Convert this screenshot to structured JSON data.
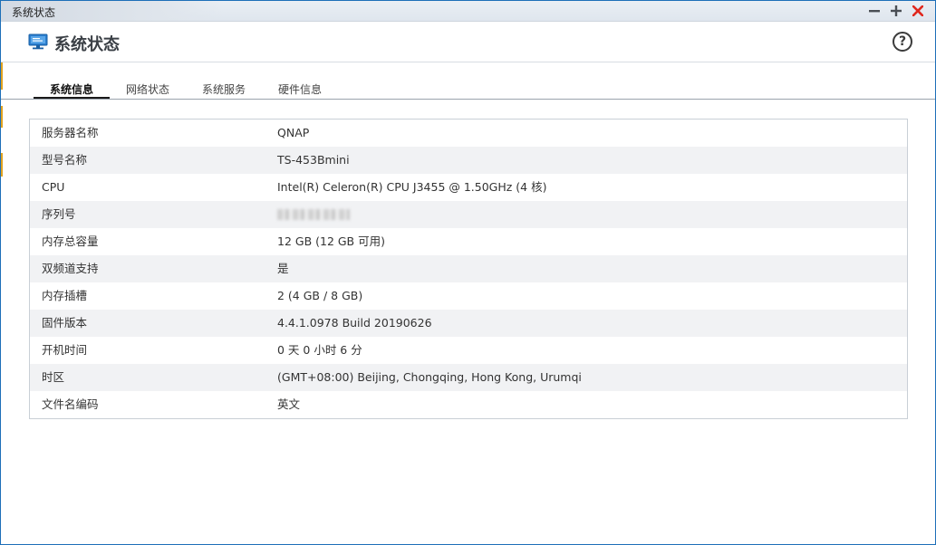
{
  "window": {
    "title": "系统状态",
    "controls": {
      "minimize": "−",
      "maximize": "+",
      "close": "✕"
    }
  },
  "header": {
    "icon": "monitor-icon",
    "title": "系统状态",
    "help": "?"
  },
  "tabs": [
    {
      "label": "系统信息",
      "active": true
    },
    {
      "label": "网络状态",
      "active": false
    },
    {
      "label": "系统服务",
      "active": false
    },
    {
      "label": "硬件信息",
      "active": false
    }
  ],
  "system_info": [
    {
      "label": "服务器名称",
      "value": "QNAP"
    },
    {
      "label": "型号名称",
      "value": "TS-453Bmini"
    },
    {
      "label": "CPU",
      "value": "Intel(R) Celeron(R) CPU J3455 @ 1.50GHz (4 核)"
    },
    {
      "label": "序列号",
      "value": "",
      "redacted": true
    },
    {
      "label": "内存总容量",
      "value": "12 GB (12 GB 可用)"
    },
    {
      "label": "双频道支持",
      "value": "是"
    },
    {
      "label": "内存插槽",
      "value": "2 (4 GB / 8 GB)"
    },
    {
      "label": "固件版本",
      "value": "4.4.1.0978 Build 20190626"
    },
    {
      "label": "开机时间",
      "value": "0 天 0 小时 6 分"
    },
    {
      "label": "时区",
      "value": "(GMT+08:00) Beijing, Chongqing, Hong Kong, Urumqi"
    },
    {
      "label": "文件名编码",
      "value": "英文"
    }
  ],
  "colors": {
    "window_border": "#1d6fb8",
    "icon_blue": "#2b7fd0",
    "alt_row": "#f1f2f4",
    "close_red": "#e0281e"
  }
}
